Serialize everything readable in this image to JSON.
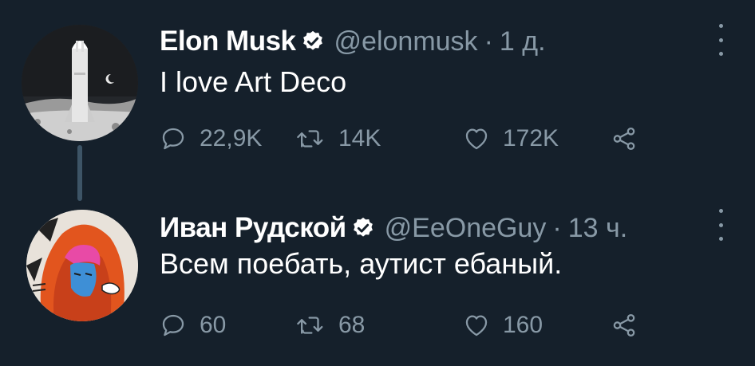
{
  "tweets": [
    {
      "name": "Elon Musk",
      "handle": "@elonmusk",
      "separator": "·",
      "time": "1 д.",
      "text": "I love Art Deco",
      "replies": "22,9K",
      "retweets": "14K",
      "likes": "172K"
    },
    {
      "name": "Иван Рудской",
      "handle": "@EeOneGuy",
      "separator": "·",
      "time": "13 ч.",
      "text": "Всем поебать, аутист ебаный.",
      "replies": "60",
      "retweets": "68",
      "likes": "160"
    }
  ],
  "colors": {
    "background": "#15202b",
    "secondary_text": "#8899a6",
    "verified": "#ffffff",
    "thread_line": "#3d5466"
  },
  "icons": [
    "verified-badge-icon",
    "more-options-icon",
    "reply-icon",
    "retweet-icon",
    "like-icon",
    "share-icon"
  ]
}
